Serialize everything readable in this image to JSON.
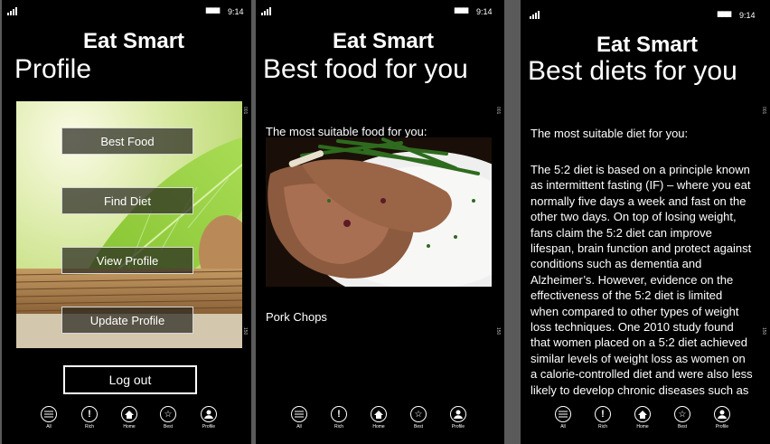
{
  "status": {
    "time": "9:14",
    "battery": "▆▆▆"
  },
  "app_title": "Eat Smart",
  "screens": {
    "profile": {
      "title": "Profile",
      "buttons": [
        "Best Food",
        "Find Diet",
        "View Profile",
        "Update Profile"
      ],
      "logout": "Log out"
    },
    "food": {
      "title": "Best food for you",
      "caption": "The most suitable food for you:",
      "food_name": "Pork Chops"
    },
    "diet": {
      "title": "Best diets for you",
      "caption": "The most suitable diet for you:",
      "description": "The 5:2 diet is based on a principle known as intermittent fasting (IF) – where you eat normally five days a week and fast on the other two days. On top of losing weight, fans claim the 5:2 diet can improve lifespan, brain function and protect against conditions such as dementia and Alzheimer’s. However, evidence on the effectiveness of the 5:2 diet is limited when compared to other types of weight loss techniques. One 2010 study found that women placed on a 5:2 diet achieved similar levels of weight loss as women on a calorie-controlled diet and were also less likely to develop chronic diseases such as"
    }
  },
  "appbar": [
    {
      "label": "All",
      "icon": "list-icon"
    },
    {
      "label": "Rich",
      "icon": "alert-icon"
    },
    {
      "label": "Home",
      "icon": "home-icon"
    },
    {
      "label": "Best",
      "icon": "star-icon"
    },
    {
      "label": "Profile",
      "icon": "profile-icon"
    }
  ],
  "scroll_marks": [
    "001",
    "150"
  ],
  "colors": {
    "background": "#000000",
    "foreground": "#ffffff",
    "leaf": "#8fce3a"
  }
}
